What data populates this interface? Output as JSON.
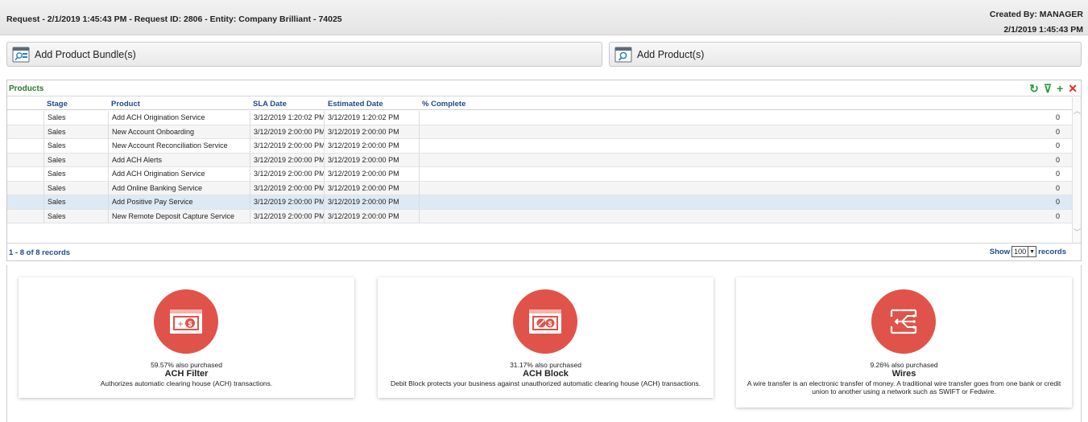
{
  "header": {
    "request_line": "Request - 2/1/2019 1:45:43 PM - Request ID: 2806 - Entity: Company Brilliant - 74025",
    "created_by": "Created By: MANAGER",
    "created_at": "2/1/2019 1:45:43 PM"
  },
  "actions": {
    "add_bundle": "Add Product Bundle(s)",
    "add_product": "Add Product(s)"
  },
  "grid": {
    "title": "Products",
    "columns": [
      "Stage",
      "Product",
      "SLA Date",
      "Estimated Date",
      "% Complete"
    ],
    "rows": [
      {
        "stage": "Sales",
        "product": "Add ACH Origination Service",
        "sla": "3/12/2019 1:20:02 PM",
        "est": "3/12/2019 1:20:02 PM",
        "complete": "0"
      },
      {
        "stage": "Sales",
        "product": "New Account Onboarding",
        "sla": "3/12/2019 2:00:00 PM",
        "est": "3/12/2019 2:00:00 PM",
        "complete": "0"
      },
      {
        "stage": "Sales",
        "product": "New Account Reconciliation Service",
        "sla": "3/12/2019 2:00:00 PM",
        "est": "3/12/2019 2:00:00 PM",
        "complete": "0"
      },
      {
        "stage": "Sales",
        "product": "Add ACH Alerts",
        "sla": "3/12/2019 2:00:00 PM",
        "est": "3/12/2019 2:00:00 PM",
        "complete": "0"
      },
      {
        "stage": "Sales",
        "product": "Add ACH Origination Service",
        "sla": "3/12/2019 2:00:00 PM",
        "est": "3/12/2019 2:00:00 PM",
        "complete": "0"
      },
      {
        "stage": "Sales",
        "product": "Add Online Banking Service",
        "sla": "3/12/2019 2:00:00 PM",
        "est": "3/12/2019 2:00:00 PM",
        "complete": "0"
      },
      {
        "stage": "Sales",
        "product": "Add Positive Pay Service",
        "sla": "3/12/2019 2:00:00 PM",
        "est": "3/12/2019 2:00:00 PM",
        "complete": "0",
        "selected": true
      },
      {
        "stage": "Sales",
        "product": "New Remote Deposit Capture Service",
        "sla": "3/12/2019 2:00:00 PM",
        "est": "3/12/2019 2:00:00 PM",
        "complete": "0"
      }
    ],
    "record_count": "1 - 8 of 8 records",
    "show_label": "Show",
    "page_size": "100",
    "records_label": "records"
  },
  "recommendations": [
    {
      "percent": "59.57% also purchased",
      "name": "ACH Filter",
      "description": "Authorizes automatic clearing house (ACH) transactions.",
      "icon": "ach-filter-icon"
    },
    {
      "percent": "31.17% also purchased",
      "name": "ACH Block",
      "description": "Debit Block protects your business against unauthorized automatic clearing house (ACH) transactions.",
      "icon": "ach-block-icon"
    },
    {
      "percent": "9.26% also purchased",
      "name": "Wires",
      "description": "A wire transfer is an electronic transfer of money. A traditional wire transfer goes from one bank or credit union to another using a network such as SWIFT or Fedwire.",
      "icon": "wires-icon"
    }
  ],
  "colors": {
    "accent_red": "#e0534a",
    "header_blue": "#1f4a8a",
    "grid_title_green": "#2a7a2a",
    "selected_row": "#dde9f4"
  }
}
